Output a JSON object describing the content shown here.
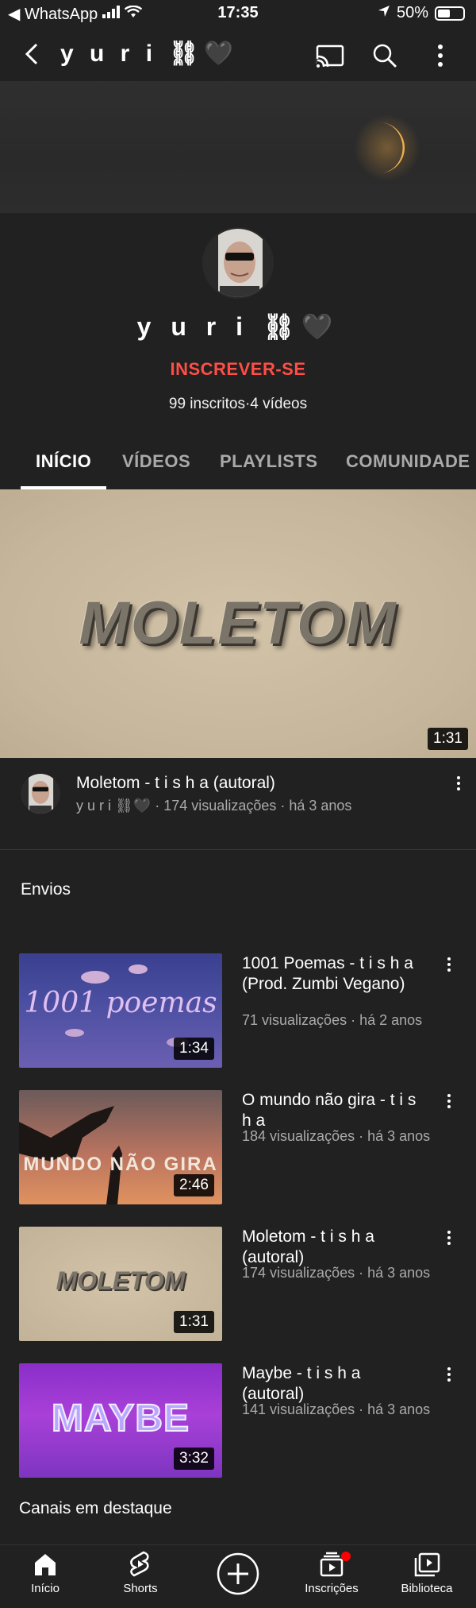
{
  "status_bar": {
    "back_app": "◀ WhatsApp",
    "time": "17:35",
    "battery_percent": "50%",
    "battery_level": 0.5
  },
  "app_bar": {
    "title": "y u r i ⛓🖤",
    "icons": [
      "back-icon",
      "cast-icon",
      "search-icon",
      "more-vert-icon"
    ]
  },
  "channel": {
    "name": "y u r i ⛓🖤",
    "subscribe_label": "INSCREVER-SE",
    "stats": "99 inscritos·4 vídeos",
    "accent_color": "#ff4e45"
  },
  "tabs": [
    {
      "label": "INÍCIO",
      "active": true
    },
    {
      "label": "VÍDEOS",
      "active": false
    },
    {
      "label": "PLAYLISTS",
      "active": false
    },
    {
      "label": "COMUNIDADE",
      "active": false
    }
  ],
  "featured_video": {
    "thumb_text": "MOLETOM",
    "duration": "1:31",
    "title": "Moletom - t i s h a (autoral)",
    "meta": "y u r i ⛓🖤 · 174 visualizações · há 3 anos"
  },
  "uploads": {
    "section_title": "Envios",
    "items": [
      {
        "thumb_text": "1001 poemas",
        "duration": "1:34",
        "title": "1001 Poemas - t i s h a (Prod. Zumbi Vegano)",
        "meta": "71 visualizações · há 2 anos"
      },
      {
        "thumb_text": "MUNDO NÃO GIRA",
        "duration": "2:46",
        "title": "O mundo não gira - t i s h a",
        "meta": "184 visualizações · há 3 anos"
      },
      {
        "thumb_text": "MOLETOM",
        "duration": "1:31",
        "title": "Moletom - t i s h a (autoral)",
        "meta": "174 visualizações · há 3 anos"
      },
      {
        "thumb_text": "MAYBE",
        "duration": "3:32",
        "title": "Maybe - t i s h a (autoral)",
        "meta": "141 visualizações · há 3 anos"
      }
    ]
  },
  "featured_channels_title": "Canais em destaque",
  "bottom_nav": [
    {
      "label": "Início",
      "icon": "home-icon"
    },
    {
      "label": "Shorts",
      "icon": "shorts-icon"
    },
    {
      "label": "",
      "icon": "create-icon"
    },
    {
      "label": "Inscrições",
      "icon": "subscriptions-icon"
    },
    {
      "label": "Biblioteca",
      "icon": "library-icon"
    }
  ]
}
